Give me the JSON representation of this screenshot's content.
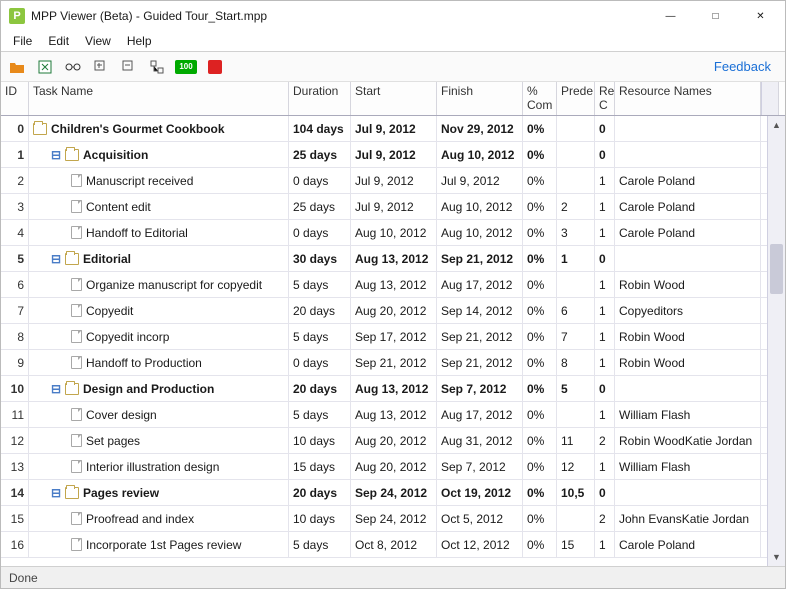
{
  "window": {
    "title": "MPP Viewer (Beta) - Guided Tour_Start.mpp",
    "app_letter": "P"
  },
  "menu": {
    "file": "File",
    "edit": "Edit",
    "view": "View",
    "help": "Help"
  },
  "toolbar": {
    "feedback": "Feedback",
    "hundred": "100"
  },
  "columns": {
    "id": "ID",
    "task": "Task Name",
    "duration": "Duration",
    "start": "Start",
    "finish": "Finish",
    "pct": "% Com",
    "pred": "Prede",
    "rc": "Re C",
    "res": "Resource Names"
  },
  "status": {
    "text": "Done"
  },
  "tasks": [
    {
      "id": "0",
      "level": 0,
      "summary": true,
      "name": "Children's Gourmet Cookbook",
      "duration": "104 days",
      "start": "Jul 9, 2012",
      "finish": "Nov 29, 2012",
      "pct": "0%",
      "pred": "",
      "rc": "0",
      "res": ""
    },
    {
      "id": "1",
      "level": 1,
      "summary": true,
      "name": "Acquisition",
      "duration": "25 days",
      "start": "Jul 9, 2012",
      "finish": "Aug 10, 2012",
      "pct": "0%",
      "pred": "",
      "rc": "0",
      "res": ""
    },
    {
      "id": "2",
      "level": 2,
      "summary": false,
      "name": "Manuscript received",
      "duration": "0 days",
      "start": "Jul 9, 2012",
      "finish": "Jul 9, 2012",
      "pct": "0%",
      "pred": "",
      "rc": "1",
      "res": "Carole Poland"
    },
    {
      "id": "3",
      "level": 2,
      "summary": false,
      "name": "Content edit",
      "duration": "25 days",
      "start": "Jul 9, 2012",
      "finish": "Aug 10, 2012",
      "pct": "0%",
      "pred": "2",
      "rc": "1",
      "res": "Carole Poland"
    },
    {
      "id": "4",
      "level": 2,
      "summary": false,
      "name": "Handoff to Editorial",
      "duration": "0 days",
      "start": "Aug 10, 2012",
      "finish": "Aug 10, 2012",
      "pct": "0%",
      "pred": "3",
      "rc": "1",
      "res": "Carole Poland"
    },
    {
      "id": "5",
      "level": 1,
      "summary": true,
      "name": "Editorial",
      "duration": "30 days",
      "start": "Aug 13, 2012",
      "finish": "Sep 21, 2012",
      "pct": "0%",
      "pred": "1",
      "rc": "0",
      "res": ""
    },
    {
      "id": "6",
      "level": 2,
      "summary": false,
      "name": "Organize manuscript for copyedit",
      "duration": "5 days",
      "start": "Aug 13, 2012",
      "finish": "Aug 17, 2012",
      "pct": "0%",
      "pred": "",
      "rc": "1",
      "res": "Robin Wood"
    },
    {
      "id": "7",
      "level": 2,
      "summary": false,
      "name": "Copyedit",
      "duration": "20 days",
      "start": "Aug 20, 2012",
      "finish": "Sep 14, 2012",
      "pct": "0%",
      "pred": "6",
      "rc": "1",
      "res": "Copyeditors"
    },
    {
      "id": "8",
      "level": 2,
      "summary": false,
      "name": "Copyedit incorp",
      "duration": "5 days",
      "start": "Sep 17, 2012",
      "finish": "Sep 21, 2012",
      "pct": "0%",
      "pred": "7",
      "rc": "1",
      "res": "Robin Wood"
    },
    {
      "id": "9",
      "level": 2,
      "summary": false,
      "name": "Handoff to Production",
      "duration": "0 days",
      "start": "Sep 21, 2012",
      "finish": "Sep 21, 2012",
      "pct": "0%",
      "pred": "8",
      "rc": "1",
      "res": "Robin Wood"
    },
    {
      "id": "10",
      "level": 1,
      "summary": true,
      "name": "Design and Production",
      "duration": "20 days",
      "start": "Aug 13, 2012",
      "finish": "Sep 7, 2012",
      "pct": "0%",
      "pred": "5",
      "rc": "0",
      "res": ""
    },
    {
      "id": "11",
      "level": 2,
      "summary": false,
      "name": "Cover design",
      "duration": "5 days",
      "start": "Aug 13, 2012",
      "finish": "Aug 17, 2012",
      "pct": "0%",
      "pred": "",
      "rc": "1",
      "res": "William Flash"
    },
    {
      "id": "12",
      "level": 2,
      "summary": false,
      "name": "Set pages",
      "duration": "10 days",
      "start": "Aug 20, 2012",
      "finish": "Aug 31, 2012",
      "pct": "0%",
      "pred": "11",
      "rc": "2",
      "res": "Robin WoodKatie Jordan"
    },
    {
      "id": "13",
      "level": 2,
      "summary": false,
      "name": "Interior illustration design",
      "duration": "15 days",
      "start": "Aug 20, 2012",
      "finish": "Sep 7, 2012",
      "pct": "0%",
      "pred": "12",
      "rc": "1",
      "res": "William Flash"
    },
    {
      "id": "14",
      "level": 1,
      "summary": true,
      "name": "Pages review",
      "duration": "20 days",
      "start": "Sep 24, 2012",
      "finish": "Oct 19, 2012",
      "pct": "0%",
      "pred": "10,5",
      "rc": "0",
      "res": ""
    },
    {
      "id": "15",
      "level": 2,
      "summary": false,
      "name": "Proofread and index",
      "duration": "10 days",
      "start": "Sep 24, 2012",
      "finish": "Oct 5, 2012",
      "pct": "0%",
      "pred": "",
      "rc": "2",
      "res": "John EvansKatie Jordan"
    },
    {
      "id": "16",
      "level": 2,
      "summary": false,
      "name": "Incorporate 1st Pages review",
      "duration": "5 days",
      "start": "Oct 8, 2012",
      "finish": "Oct 12, 2012",
      "pct": "0%",
      "pred": "15",
      "rc": "1",
      "res": "Carole Poland"
    }
  ]
}
